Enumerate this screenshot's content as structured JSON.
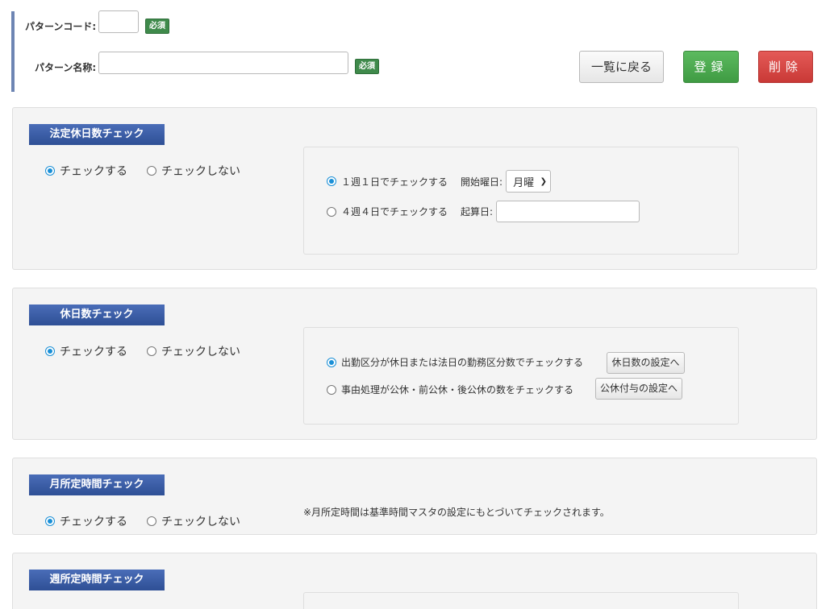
{
  "header": {
    "pattern_code_label": "パターンコード:",
    "pattern_name_label": "パターン名称:",
    "required_badge": "必須",
    "back_button": "一覧に戻る",
    "register_button": "登録",
    "delete_button": "削除"
  },
  "sections": {
    "legal_holiday": {
      "title": "法定休日数チェック",
      "check_on": "チェックする",
      "check_off": "チェックしない",
      "option_weekly": "１週１日でチェックする",
      "start_day_label": "開始曜日:",
      "start_day_value": "月曜",
      "option_4week": "４週４日でチェックする",
      "calc_date_label": "起算日:"
    },
    "holiday_count": {
      "title": "休日数チェック",
      "check_on": "チェックする",
      "check_off": "チェックしない",
      "option_attendance": "出勤区分が休日または法日の勤務区分数でチェックする",
      "holiday_settings_button": "休日数の設定へ",
      "option_reason": "事由処理が公休・前公休・後公休の数をチェックする",
      "public_holiday_button": "公休付与の設定へ"
    },
    "monthly_hours": {
      "title": "月所定時間チェック",
      "check_on": "チェックする",
      "check_off": "チェックしない",
      "note": "※月所定時間は基準時間マスタの設定にもとづいてチェックされます。"
    },
    "weekly_hours": {
      "title": "週所定時間チェック"
    }
  }
}
